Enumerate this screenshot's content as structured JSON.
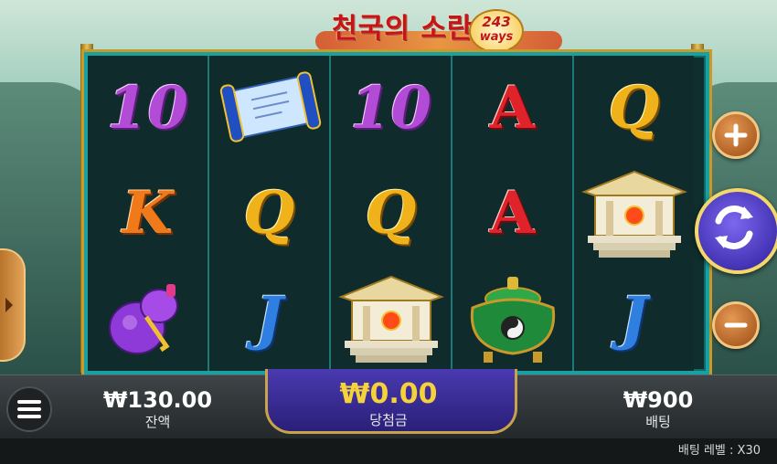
{
  "title": {
    "game_name": "천국의 소란",
    "ways_number": "243",
    "ways_word": "ways"
  },
  "reels": [
    [
      {
        "symbol": "10",
        "kind": "glyph"
      },
      {
        "symbol": "K",
        "kind": "glyph"
      },
      {
        "symbol": "gourd",
        "kind": "icon",
        "icon": "gourd-icon"
      }
    ],
    [
      {
        "symbol": "scroll",
        "kind": "icon",
        "icon": "scroll-icon"
      },
      {
        "symbol": "Q",
        "kind": "glyph"
      },
      {
        "symbol": "J",
        "kind": "glyph"
      }
    ],
    [
      {
        "symbol": "10",
        "kind": "glyph"
      },
      {
        "symbol": "Q",
        "kind": "glyph"
      },
      {
        "symbol": "temple",
        "kind": "icon",
        "icon": "temple-icon"
      }
    ],
    [
      {
        "symbol": "A",
        "kind": "glyph"
      },
      {
        "symbol": "A",
        "kind": "glyph"
      },
      {
        "symbol": "cauldron",
        "kind": "icon",
        "icon": "cauldron-icon"
      }
    ],
    [
      {
        "symbol": "Q",
        "kind": "glyph"
      },
      {
        "symbol": "temple",
        "kind": "icon",
        "icon": "temple-icon"
      },
      {
        "symbol": "J",
        "kind": "glyph"
      }
    ]
  ],
  "controls": {
    "plus_icon": "plus-icon",
    "spin_icon": "refresh-icon",
    "minus_icon": "minus-icon",
    "menu_icon": "hamburger-icon",
    "side_tab_icon": "chevron-right-icon"
  },
  "balance": {
    "value": "₩130.00",
    "label": "잔액"
  },
  "win": {
    "value": "₩0.00",
    "label": "당첨금"
  },
  "bet": {
    "value": "₩900",
    "label": "배팅"
  },
  "bet_level": {
    "label": "배팅 레벨 :",
    "value": "X30"
  },
  "colors": {
    "win_value": "#f6d23a",
    "frame": "#1aa0a0",
    "gold": "#c89a2a",
    "spin_button": "#4a34d0"
  }
}
